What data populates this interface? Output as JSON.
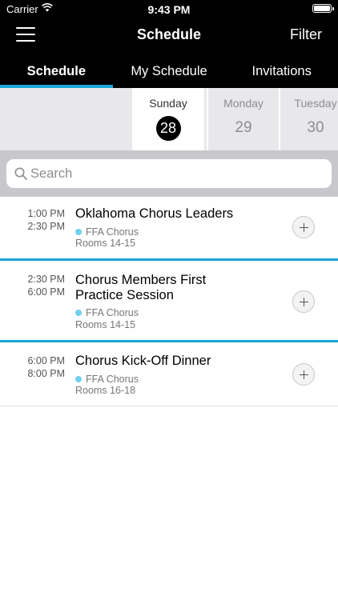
{
  "status": {
    "carrier": "Carrier",
    "time": "9:43 PM"
  },
  "nav": {
    "title": "Schedule",
    "filter_label": "Filter"
  },
  "tabs": [
    {
      "label": "Schedule",
      "active": true
    },
    {
      "label": "My Schedule",
      "active": false
    },
    {
      "label": "Invitations",
      "active": false
    }
  ],
  "days": [
    {
      "name": "Sunday",
      "number": "28",
      "selected": true
    },
    {
      "name": "Monday",
      "number": "29",
      "selected": false
    },
    {
      "name": "Tuesday",
      "number": "30",
      "selected": false
    }
  ],
  "search": {
    "placeholder": "Search",
    "value": ""
  },
  "events": [
    {
      "start": "1:00 PM",
      "end": "2:30 PM",
      "title": "Oklahoma Chorus Leaders",
      "track": "FFA Chorus",
      "location": "Rooms 14-15"
    },
    {
      "start": "2:30 PM",
      "end": "6:00 PM",
      "title": "Chorus Members First Practice Session",
      "track": "FFA Chorus",
      "location": "Rooms 14-15"
    },
    {
      "start": "6:00 PM",
      "end": "8:00 PM",
      "title": "Chorus Kick-Off Dinner",
      "track": "FFA Chorus",
      "location": "Rooms 16-18"
    }
  ],
  "colors": {
    "accent": "#1aa5d8",
    "track_dot": "#6fd0ee",
    "header_bg": "#000000"
  },
  "icons": {
    "menu": "hamburger-menu-icon",
    "search": "search-icon",
    "add": "plus-icon",
    "wifi": "wifi-icon",
    "battery": "battery-icon"
  }
}
